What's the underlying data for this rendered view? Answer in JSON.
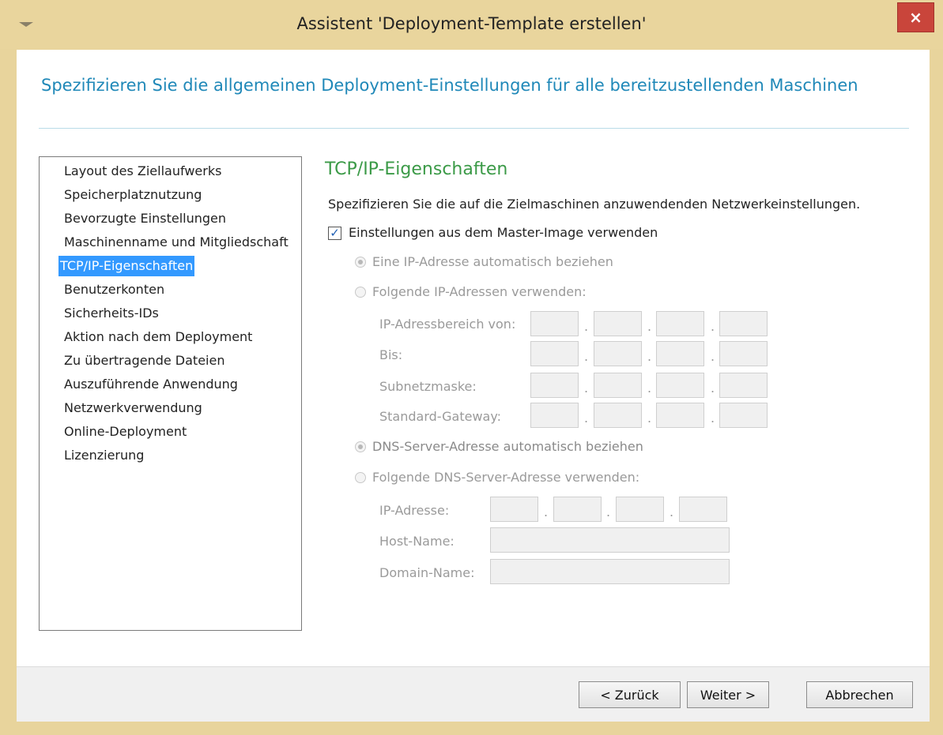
{
  "window": {
    "title": "Assistent 'Deployment-Template erstellen'",
    "close_glyph": "×"
  },
  "heading": "Spezifizieren Sie die allgemeinen Deployment-Einstellungen für alle bereitzustellenden Maschinen",
  "nav": {
    "items": [
      "Layout des Ziellaufwerks",
      "Speicherplatznutzung",
      "Bevorzugte Einstellungen",
      "Maschinenname und Mitgliedschaft",
      "TCP/IP-Eigenschaften",
      "Benutzerkonten",
      "Sicherheits-IDs",
      "Aktion nach dem Deployment",
      "Zu übertragende Dateien",
      "Auszuführende Anwendung",
      "Netzwerkverwendung",
      "Online-Deployment",
      "Lizenzierung"
    ],
    "selected": "TCP/IP-Eigenschaften"
  },
  "section": {
    "title": "TCP/IP-Eigenschaften",
    "description": "Spezifizieren Sie die auf die Zielmaschinen anzuwendenden Netzwerkeinstellungen.",
    "use_master_label": "Einstellungen aus dem Master-Image verwenden",
    "use_master_checked": true,
    "ip_auto_label": "Eine IP-Adresse automatisch beziehen",
    "ip_manual_label": "Folgende IP-Adressen verwenden:",
    "ip_range_from_label": "IP-Adressbereich von:",
    "ip_range_to_label": "Bis:",
    "subnet_label": "Subnetzmaske:",
    "gateway_label": "Standard-Gateway:",
    "dns_auto_label": "DNS-Server-Adresse automatisch beziehen",
    "dns_manual_label": "Folgende DNS-Server-Adresse verwenden:",
    "dns_ip_label": "IP-Adresse:",
    "host_name_label": "Host-Name:",
    "domain_name_label": "Domain-Name:",
    "octet_separator": "."
  },
  "buttons": {
    "back": "< Zurück",
    "next": "Weiter >",
    "cancel": "Abbrechen"
  },
  "colors": {
    "heading": "#1f88b8",
    "section_title": "#3b9a47",
    "selection": "#3399ff",
    "close": "#c9453b"
  }
}
